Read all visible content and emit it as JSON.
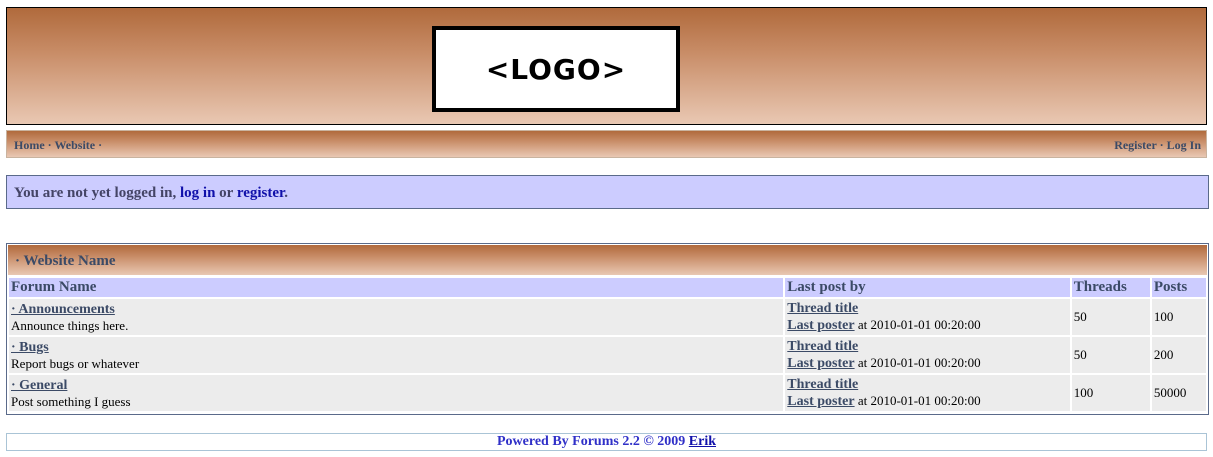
{
  "header": {
    "logo_text": "<LOGO>"
  },
  "nav": {
    "left": [
      {
        "label": "Home"
      },
      {
        "label": "Website"
      }
    ],
    "right": [
      {
        "label": "Register"
      },
      {
        "label": "Log In"
      }
    ],
    "separator": "·"
  },
  "notice": {
    "prefix": "You are not yet logged in,",
    "login_link": "log in",
    "middle": "or",
    "register_link": "register",
    "suffix": "."
  },
  "category": {
    "title": "· Website Name"
  },
  "table": {
    "columns": [
      "Forum Name",
      "Last post by",
      "Threads",
      "Posts"
    ],
    "rows": [
      {
        "name": "· Announcements",
        "desc": "Announce things here.",
        "thread": "Thread title",
        "poster": "Last poster",
        "at": "at 2010-01-01 00:20:00",
        "threads": "50",
        "posts": "100"
      },
      {
        "name": "· Bugs",
        "desc": "Report bugs or whatever",
        "thread": "Thread title",
        "poster": "Last poster",
        "at": "at 2010-01-01 00:20:00",
        "threads": "50",
        "posts": "200"
      },
      {
        "name": "· General",
        "desc": "Post something I guess",
        "thread": "Thread title",
        "poster": "Last poster",
        "at": "at 2010-01-01 00:20:00",
        "threads": "100",
        "posts": "50000"
      }
    ]
  },
  "footer": {
    "text": "Powered By Forums 2.2 © 2009",
    "author": "Erik"
  },
  "colors": {
    "header_gradient_top": "#b06a3c",
    "header_gradient_bottom": "#e9c8b3",
    "notice_bg": "#ccccff",
    "link": "#1010aa",
    "label": "#3b4a66"
  }
}
